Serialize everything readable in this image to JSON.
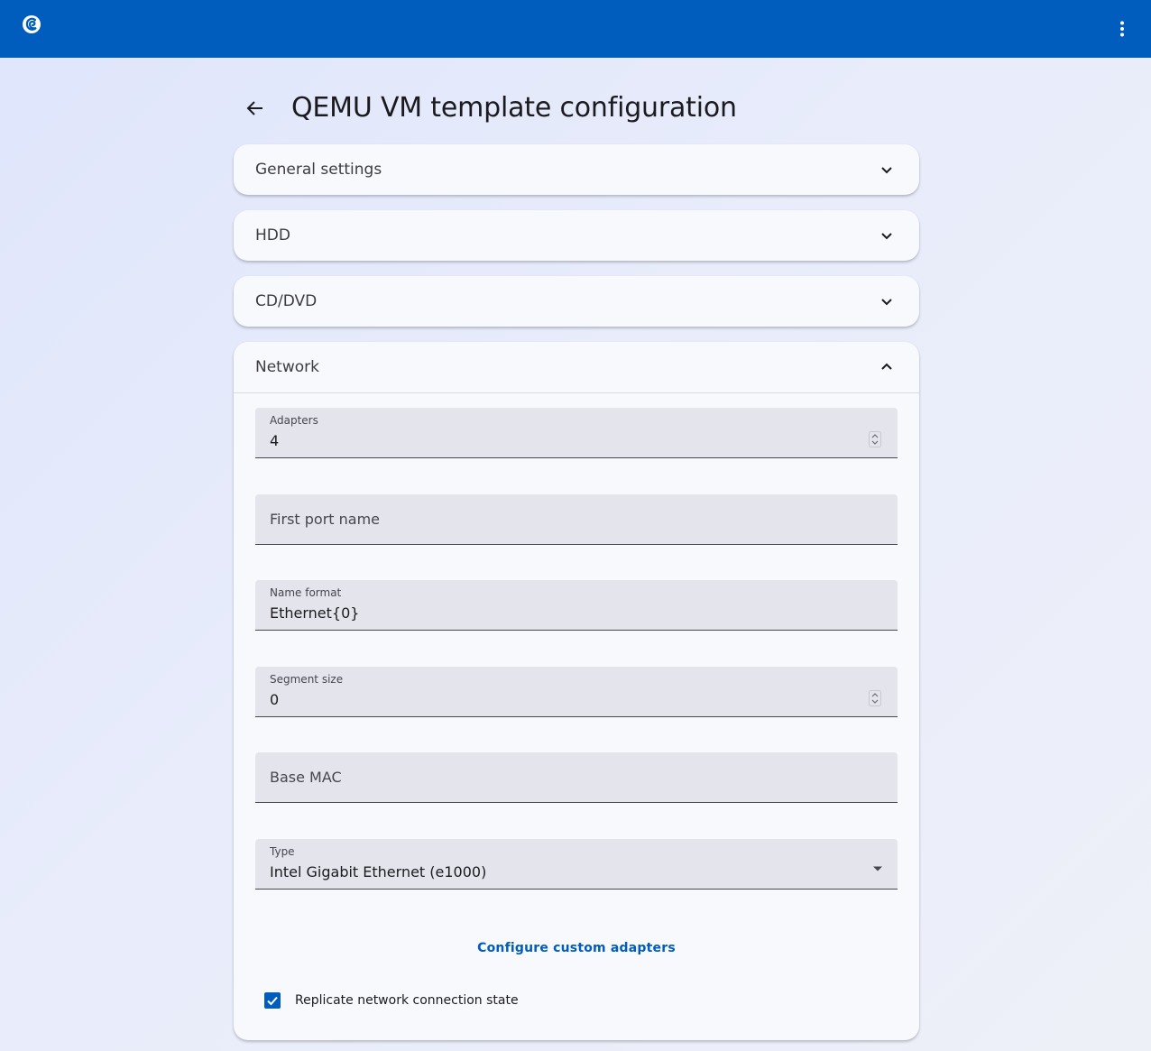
{
  "page": {
    "title": "QEMU VM template configuration"
  },
  "icons": {
    "logo": "gns3-chameleon-icon",
    "menu": "more-vert-icon",
    "back": "arrow-back-icon"
  },
  "colors": {
    "primary": "#005cbd",
    "panel": "#f8f9fd",
    "field": "#e4e5ec"
  },
  "panels": {
    "general": {
      "title": "General settings",
      "expanded": false
    },
    "hdd": {
      "title": "HDD",
      "expanded": false
    },
    "cdrom": {
      "title": "CD/DVD",
      "expanded": false
    },
    "network": {
      "title": "Network",
      "expanded": true
    }
  },
  "network": {
    "adapters": {
      "label": "Adapters",
      "value": "4"
    },
    "first_port_name": {
      "placeholder": "First port name",
      "value": ""
    },
    "name_format": {
      "label": "Name format",
      "value": "Ethernet{0}"
    },
    "segment_size": {
      "label": "Segment size",
      "value": "0"
    },
    "base_mac": {
      "placeholder": "Base MAC",
      "value": ""
    },
    "type": {
      "label": "Type",
      "value": "Intel Gigabit Ethernet (e1000)"
    },
    "configure_custom_adapters": "Configure custom adapters",
    "replicate_state": {
      "label": "Replicate network connection state",
      "checked": true
    }
  }
}
